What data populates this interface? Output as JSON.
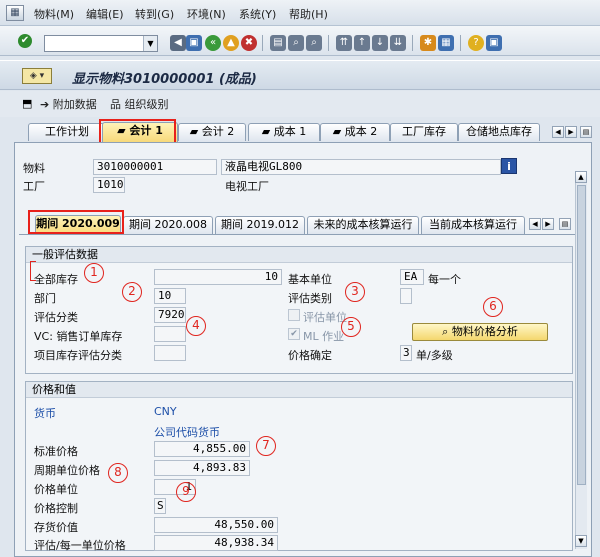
{
  "menu": [
    "物料(M)",
    "编辑(E)",
    "转到(G)",
    "环境(N)",
    "系统(Y)",
    "帮助(H)"
  ],
  "title": "显示物料3010000001 (成品)",
  "app_toolbar": {
    "additional_data": "附加数据",
    "org_levels": "组织级别"
  },
  "tabs": [
    "工作计划",
    "会计 1",
    "会计 2",
    "成本 1",
    "成本 2",
    "工厂库存",
    "仓储地点库存"
  ],
  "header": {
    "material_label": "物料",
    "material_value": "3010000001",
    "material_desc": "液晶电视GL800",
    "plant_label": "工厂",
    "plant_value": "1010",
    "plant_desc": "电视工厂"
  },
  "period_tabs": [
    "期间 2020.009",
    "期间 2020.008",
    "期间 2019.012",
    "未来的成本核算运行",
    "当前成本核算运行"
  ],
  "general": {
    "heading": "一般评估数据",
    "total_stock_label": "全部库存",
    "total_stock_value": "10",
    "base_unit_label": "基本单位",
    "base_unit_value": "EA",
    "base_unit_text": "每一个",
    "division_label": "部门",
    "division_value": "10",
    "valuation_cat_label": "评估类别",
    "valuation_class_label": "评估分类",
    "valuation_class_value": "7920",
    "valuation_unit_label": "评估单位",
    "vc_label": "VC: 销售订单库存",
    "ml_label": "ML 作业",
    "price_analysis_button": "物料价格分析",
    "project_stock_label": "项目库存评估分类",
    "price_determination_label": "价格确定",
    "price_determination_value": "3",
    "price_determination_text": "单/多级"
  },
  "prices": {
    "heading": "价格和值",
    "currency_label": "货币",
    "currency_value": "CNY",
    "company_currency": "公司代码货币",
    "standard_price_label": "标准价格",
    "standard_price_value": "4,855.00",
    "periodic_price_label": "周期单位价格",
    "periodic_price_value": "4,893.83",
    "price_unit_label": "价格单位",
    "price_unit_value": "1",
    "price_control_label": "价格控制",
    "price_control_value": "S",
    "inventory_value_label": "存货价值",
    "inventory_value_value": "48,550.00",
    "valuated_price_label": "评估/每一单位价格",
    "valuated_price_value": "48,938.34"
  },
  "annotations": [
    "1",
    "2",
    "3",
    "4",
    "5",
    "6",
    "7",
    "8",
    "9"
  ],
  "colors": {
    "highlight": "#e8211b",
    "annotation": "#e0251f",
    "link": "#1d4fa8",
    "active_tab": "#f7d97a"
  }
}
